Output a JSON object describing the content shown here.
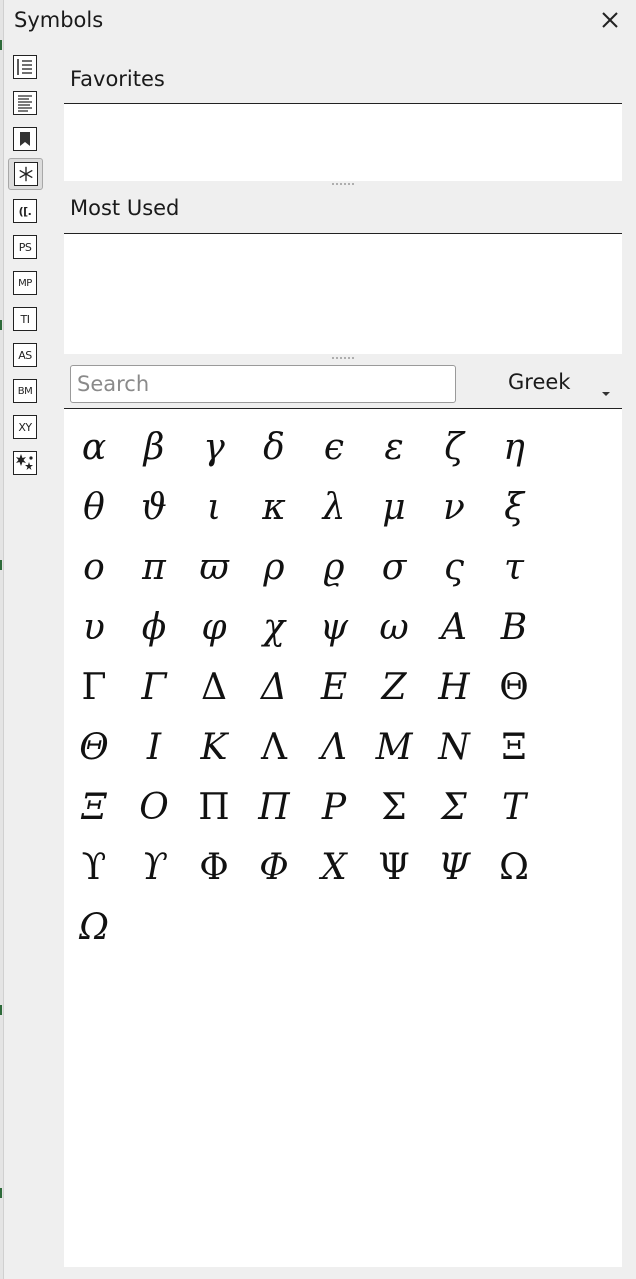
{
  "window": {
    "title": "Symbols",
    "close_icon": "close-icon"
  },
  "toolbar": {
    "items": [
      {
        "icon": "numbered-list-icon"
      },
      {
        "icon": "text-lines-icon"
      },
      {
        "icon": "bookmark-icon"
      },
      {
        "icon": "asterisk-icon",
        "selected": true
      },
      {
        "icon": "bracket-icon",
        "label": "([."
      },
      {
        "icon": "ps-icon",
        "label": "PS"
      },
      {
        "icon": "mp-icon",
        "label": "MP"
      },
      {
        "icon": "ti-icon",
        "label": "TI"
      },
      {
        "icon": "as-icon",
        "label": "AS"
      },
      {
        "icon": "bm-icon",
        "label": "BM"
      },
      {
        "icon": "xy-icon",
        "label": "XY"
      },
      {
        "icon": "sparkles-icon"
      }
    ]
  },
  "sections": {
    "favorites": {
      "title": "Favorites"
    },
    "most_used": {
      "title": "Most Used"
    }
  },
  "search": {
    "placeholder": "Search",
    "value": ""
  },
  "category": {
    "selected": "Greek"
  },
  "symbols": [
    {
      "c": "α",
      "i": true
    },
    {
      "c": "β",
      "i": true
    },
    {
      "c": "γ",
      "i": true
    },
    {
      "c": "δ",
      "i": true
    },
    {
      "c": "ϵ",
      "i": true
    },
    {
      "c": "ε",
      "i": true
    },
    {
      "c": "ζ",
      "i": true
    },
    {
      "c": "η",
      "i": true
    },
    {
      "c": "θ",
      "i": true
    },
    {
      "c": "ϑ",
      "i": true
    },
    {
      "c": "ι",
      "i": true
    },
    {
      "c": "κ",
      "i": true
    },
    {
      "c": "λ",
      "i": true
    },
    {
      "c": "μ",
      "i": true
    },
    {
      "c": "ν",
      "i": true
    },
    {
      "c": "ξ",
      "i": true
    },
    {
      "c": "o",
      "i": true
    },
    {
      "c": "π",
      "i": true
    },
    {
      "c": "ϖ",
      "i": true
    },
    {
      "c": "ρ",
      "i": true
    },
    {
      "c": "ϱ",
      "i": true
    },
    {
      "c": "σ",
      "i": true
    },
    {
      "c": "ς",
      "i": true
    },
    {
      "c": "τ",
      "i": true
    },
    {
      "c": "υ",
      "i": true
    },
    {
      "c": "ϕ",
      "i": true
    },
    {
      "c": "φ",
      "i": true
    },
    {
      "c": "χ",
      "i": true
    },
    {
      "c": "ψ",
      "i": true
    },
    {
      "c": "ω",
      "i": true
    },
    {
      "c": "A",
      "i": true
    },
    {
      "c": "B",
      "i": true
    },
    {
      "c": "Γ",
      "i": false
    },
    {
      "c": "Γ",
      "i": true
    },
    {
      "c": "Δ",
      "i": false
    },
    {
      "c": "Δ",
      "i": true
    },
    {
      "c": "E",
      "i": true
    },
    {
      "c": "Z",
      "i": true
    },
    {
      "c": "H",
      "i": true
    },
    {
      "c": "Θ",
      "i": false
    },
    {
      "c": "Θ",
      "i": true
    },
    {
      "c": "I",
      "i": true
    },
    {
      "c": "K",
      "i": true
    },
    {
      "c": "Λ",
      "i": false
    },
    {
      "c": "Λ",
      "i": true
    },
    {
      "c": "M",
      "i": true
    },
    {
      "c": "N",
      "i": true
    },
    {
      "c": "Ξ",
      "i": false
    },
    {
      "c": "Ξ",
      "i": true
    },
    {
      "c": "O",
      "i": true
    },
    {
      "c": "Π",
      "i": false
    },
    {
      "c": "Π",
      "i": true
    },
    {
      "c": "P",
      "i": true
    },
    {
      "c": "Σ",
      "i": false
    },
    {
      "c": "Σ",
      "i": true
    },
    {
      "c": "T",
      "i": true
    },
    {
      "c": "ϒ",
      "i": false
    },
    {
      "c": "ϒ",
      "i": true
    },
    {
      "c": "Φ",
      "i": false
    },
    {
      "c": "Φ",
      "i": true
    },
    {
      "c": "X",
      "i": true
    },
    {
      "c": "Ψ",
      "i": false
    },
    {
      "c": "Ψ",
      "i": true
    },
    {
      "c": "Ω",
      "i": false
    },
    {
      "c": "Ω",
      "i": true
    }
  ]
}
